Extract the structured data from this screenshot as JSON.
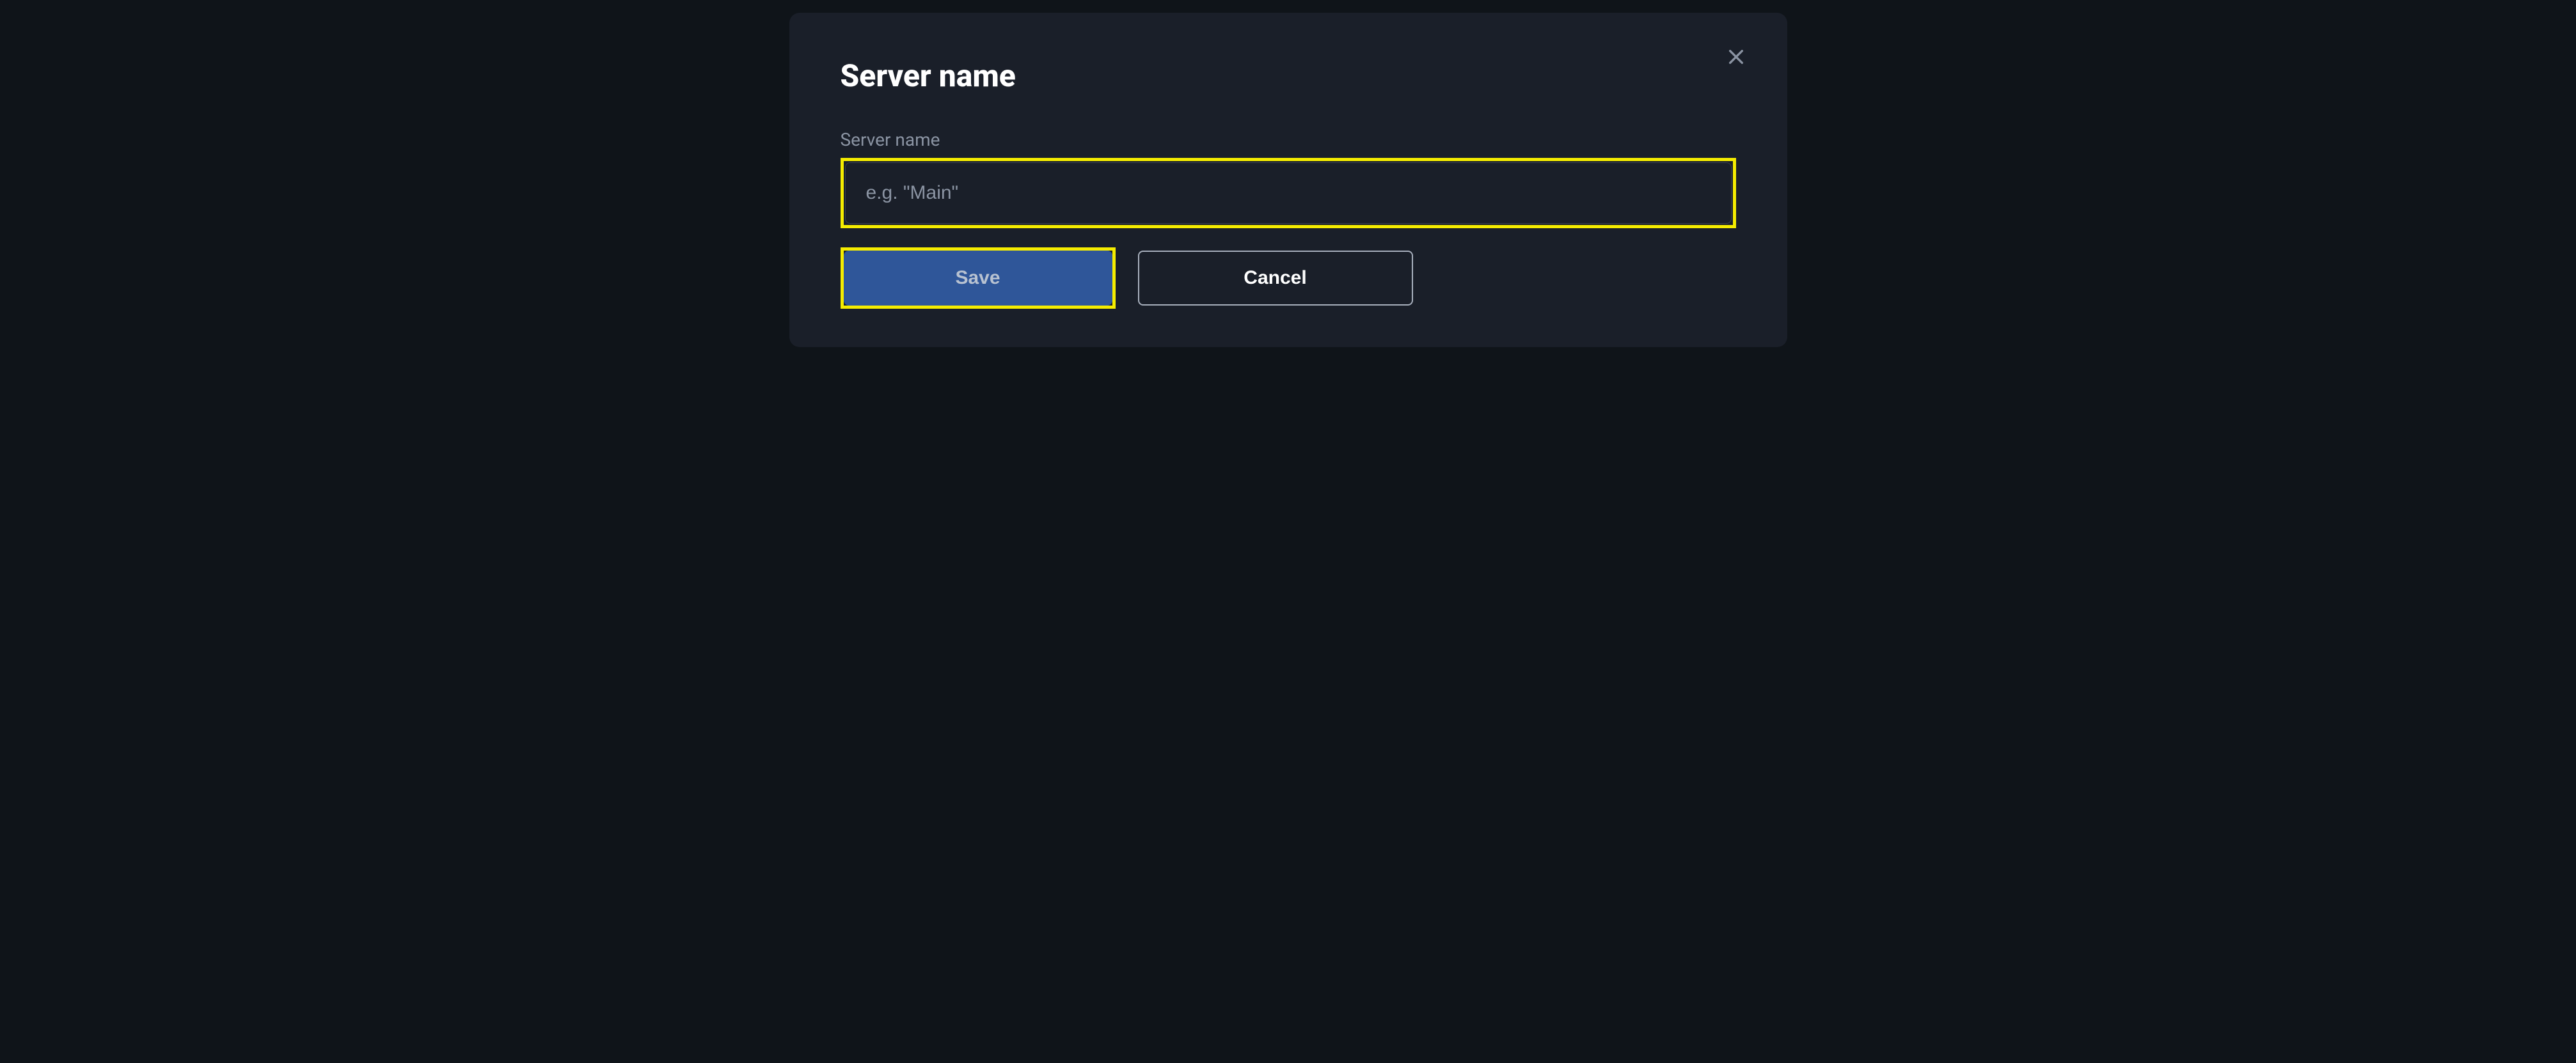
{
  "dialog": {
    "title": "Server name",
    "field_label": "Server name",
    "input_placeholder": "e.g. \"Main\"",
    "input_value": "",
    "save_label": "Save",
    "cancel_label": "Cancel"
  }
}
